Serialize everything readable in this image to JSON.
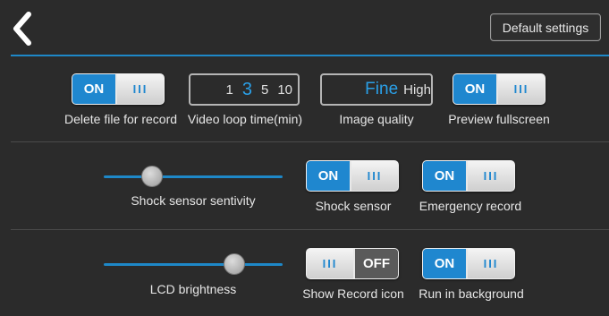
{
  "header": {
    "default_settings_label": "Default settings"
  },
  "row1": {
    "delete_file": {
      "state": "ON",
      "label": "Delete file for record"
    },
    "video_loop": {
      "options": [
        "1",
        "3",
        "5",
        "10"
      ],
      "selected": "3",
      "label": "Video loop time(min)"
    },
    "image_quality": {
      "options": [
        "Fine",
        "High"
      ],
      "selected": "Fine",
      "label": "Image quality"
    },
    "preview_fullscreen": {
      "state": "ON",
      "label": "Preview fullscreen"
    }
  },
  "row2": {
    "shock_sensitivity": {
      "label": "Shock sensor sentivity",
      "level": 0.27
    },
    "shock_sensor": {
      "state": "ON",
      "label": "Shock sensor"
    },
    "emergency_record": {
      "state": "ON",
      "label": "Emergency record"
    }
  },
  "row3": {
    "lcd_brightness": {
      "label": "LCD brightness",
      "level": 0.73
    },
    "show_record_icon": {
      "state": "OFF",
      "label": "Show Record icon"
    },
    "run_in_background": {
      "state": "ON",
      "label": "Run in background"
    }
  },
  "knob_glyph": "III",
  "colors": {
    "accent": "#1f87cf",
    "background": "#2b2b2b"
  }
}
